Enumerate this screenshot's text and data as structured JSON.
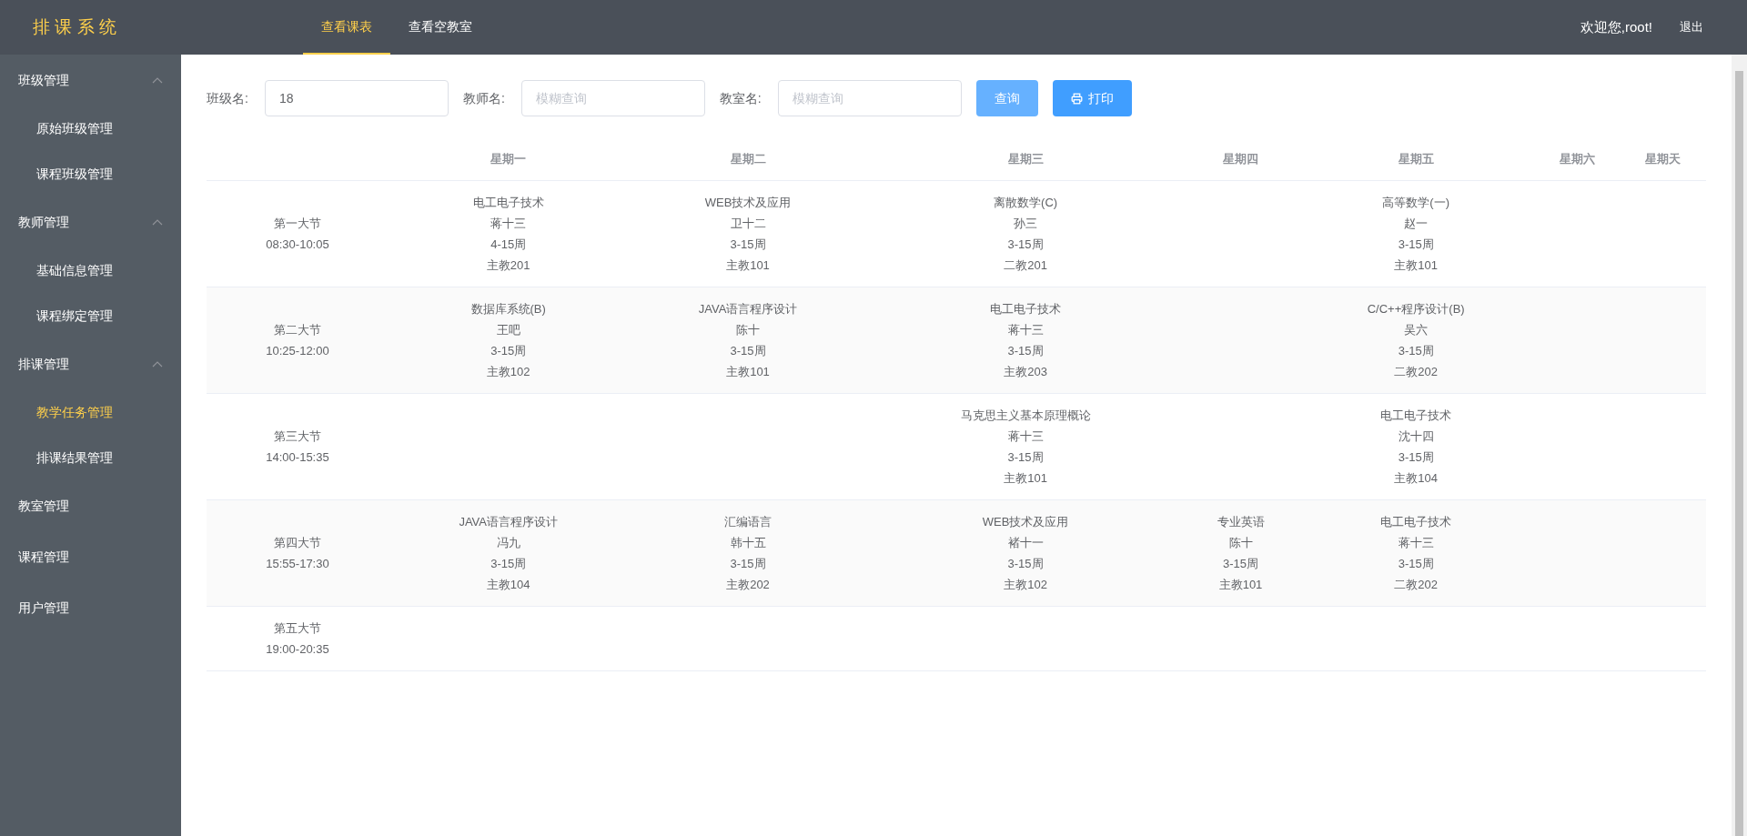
{
  "header": {
    "logo": "排 课 系 统",
    "tabs": [
      {
        "label": "查看课表",
        "selected": true
      },
      {
        "label": "查看空教室",
        "selected": false
      }
    ],
    "welcome": "欢迎您,root!",
    "logout": "退出"
  },
  "sidebar": {
    "groups": [
      {
        "label": "班级管理",
        "expanded": true,
        "children": [
          {
            "label": "原始班级管理",
            "selected": false
          },
          {
            "label": "课程班级管理",
            "selected": false
          }
        ]
      },
      {
        "label": "教师管理",
        "expanded": true,
        "children": [
          {
            "label": "基础信息管理",
            "selected": false
          },
          {
            "label": "课程绑定管理",
            "selected": false
          }
        ]
      },
      {
        "label": "排课管理",
        "expanded": true,
        "children": [
          {
            "label": "教学任务管理",
            "selected": true
          },
          {
            "label": "排课结果管理",
            "selected": false
          }
        ]
      },
      {
        "label": "教室管理"
      },
      {
        "label": "课程管理"
      },
      {
        "label": "用户管理"
      }
    ]
  },
  "filters": [
    {
      "label": "班级名:",
      "value": "18"
    },
    {
      "label": "教师名:",
      "placeholder": "模糊查询"
    },
    {
      "label": "教室名:",
      "placeholder": "模糊查询"
    }
  ],
  "buttons": {
    "query": "查询",
    "print": "打印"
  },
  "table": {
    "columns": [
      "星期一",
      "星期二",
      "星期三",
      "星期四",
      "星期五",
      "星期六",
      "星期天"
    ],
    "rows": [
      {
        "period": "第一大节",
        "time": "08:30-10:05",
        "cells": [
          [
            "电工电子技术",
            "蒋十三",
            "4-15周",
            "主教201"
          ],
          [
            "WEB技术及应用",
            "卫十二",
            "3-15周",
            "主教101"
          ],
          [
            "离散数学(C)",
            "孙三",
            "3-15周",
            "二教201"
          ],
          [],
          [
            "高等数学(一)",
            "赵一",
            "3-15周",
            "主教101"
          ],
          [],
          []
        ]
      },
      {
        "period": "第二大节",
        "time": "10:25-12:00",
        "cells": [
          [
            "数据库系统(B)",
            "王吧",
            "3-15周",
            "主教102"
          ],
          [
            "JAVA语言程序设计",
            "陈十",
            "3-15周",
            "主教101"
          ],
          [
            "电工电子技术",
            "蒋十三",
            "3-15周",
            "主教203"
          ],
          [],
          [
            "C/C++程序设计(B)",
            "吴六",
            "3-15周",
            "二教202"
          ],
          [],
          []
        ]
      },
      {
        "period": "第三大节",
        "time": "14:00-15:35",
        "cells": [
          [],
          [],
          [
            "马克思主义基本原理概论",
            "蒋十三",
            "3-15周",
            "主教101"
          ],
          [],
          [
            "电工电子技术",
            "沈十四",
            "3-15周",
            "主教104"
          ],
          [],
          []
        ]
      },
      {
        "period": "第四大节",
        "time": "15:55-17:30",
        "cells": [
          [
            "JAVA语言程序设计",
            "冯九",
            "3-15周",
            "主教104"
          ],
          [
            "汇编语言",
            "韩十五",
            "3-15周",
            "主教202"
          ],
          [
            "WEB技术及应用",
            "褚十一",
            "3-15周",
            "主教102"
          ],
          [
            "专业英语",
            "陈十",
            "3-15周",
            "主教101"
          ],
          [
            "电工电子技术",
            "蒋十三",
            "3-15周",
            "二教202"
          ],
          [],
          []
        ]
      },
      {
        "period": "第五大节",
        "time": "19:00-20:35",
        "cells": [
          [],
          [],
          [],
          [],
          [],
          [],
          []
        ]
      }
    ]
  }
}
